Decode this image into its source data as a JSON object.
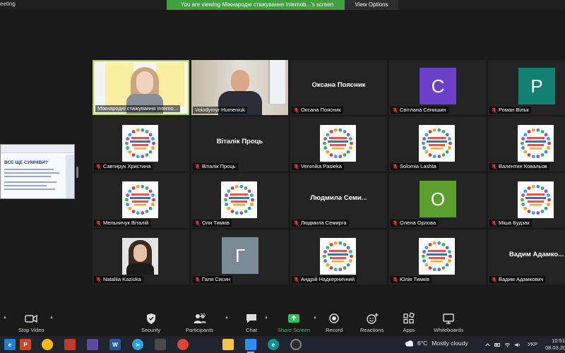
{
  "window": {
    "title": "eeting"
  },
  "share_banner": {
    "text": "You are viewing Міжнародні стажування Internob...'s screen",
    "view_options": "View Options"
  },
  "shared_slide": {
    "title": "ВСЕ ЩЕ СУМНІВИ?"
  },
  "tiles": [
    {
      "name": "Міжнародні стажування Interno...",
      "muted": false,
      "kind": "video",
      "video": "presenter",
      "active": true
    },
    {
      "name": "Volodymyr Humeniuk",
      "muted": false,
      "kind": "video",
      "video": "man"
    },
    {
      "name": "Оксана Поясник",
      "muted": true,
      "kind": "text",
      "display": "Оксана Поясник"
    },
    {
      "name": "Світлана Сенишин",
      "muted": true,
      "kind": "initial",
      "initial": "C",
      "color": "#6a3fc9"
    },
    {
      "name": "Роман Вільк",
      "muted": true,
      "kind": "initial",
      "initial": "P",
      "color": "#138071"
    },
    {
      "name": "Савтирук Христина",
      "muted": true,
      "kind": "logo"
    },
    {
      "name": "Віталік Проць",
      "muted": true,
      "kind": "text",
      "display": "Віталік Проць"
    },
    {
      "name": "Veronika Pasieka",
      "muted": true,
      "kind": "logo"
    },
    {
      "name": "Solomia Lashta",
      "muted": true,
      "kind": "logo"
    },
    {
      "name": "Валентин Ковальов",
      "muted": true,
      "kind": "logo"
    },
    {
      "name": "Мельничук Віталій",
      "muted": true,
      "kind": "logo"
    },
    {
      "name": "Оля Тимків",
      "muted": true,
      "kind": "logo"
    },
    {
      "name": "Людмила Семирга",
      "muted": true,
      "kind": "text",
      "display": "Людмила Семи..."
    },
    {
      "name": "Олена Орлова",
      "muted": true,
      "kind": "initial",
      "initial": "O",
      "color": "#5a9e2c"
    },
    {
      "name": "Міша Будзак",
      "muted": true,
      "kind": "logo"
    },
    {
      "name": "Nataliia Kaziuka",
      "muted": true,
      "kind": "video",
      "video": "woman"
    },
    {
      "name": "Галя Сисин",
      "muted": true,
      "kind": "initial",
      "initial": "Г",
      "color": "#7a8b95"
    },
    {
      "name": "Андрій Надкерничний",
      "muted": true,
      "kind": "logo"
    },
    {
      "name": "Юлія Тимків",
      "muted": true,
      "kind": "logo"
    },
    {
      "name": "Вадим Адамкович",
      "muted": true,
      "kind": "text",
      "display": "Вадим Адамко..."
    }
  ],
  "toolbar": {
    "stop_video": "Stop Video",
    "security": "Security",
    "participants": "Participants",
    "participants_count": "20",
    "chat": "Chat",
    "share_screen": "Share Screen",
    "record": "Record",
    "reactions": "Reactions",
    "apps": "Apps",
    "whiteboards": "Whiteboards"
  },
  "taskbar": {
    "apps": [
      "edge-icon",
      "powerpoint-icon",
      "chrome-icon",
      "document-icon",
      "archive-icon",
      "word-icon",
      "telegram-icon",
      "calculator-icon",
      "chrome-icon-2",
      "file-explorer-icon",
      "zoom-icon",
      "edge-icon-2",
      "obs-icon"
    ],
    "weather": {
      "temp": "6°C",
      "condition": "Mostly cloudy"
    },
    "language": "УКР",
    "time": "10:51",
    "date": "08.03.20"
  },
  "colors": {
    "share_banner": "#3fa03f",
    "active_speaker": "#b2d235",
    "mic_muted": "#e0383e",
    "share_screen": "#23c55e"
  }
}
